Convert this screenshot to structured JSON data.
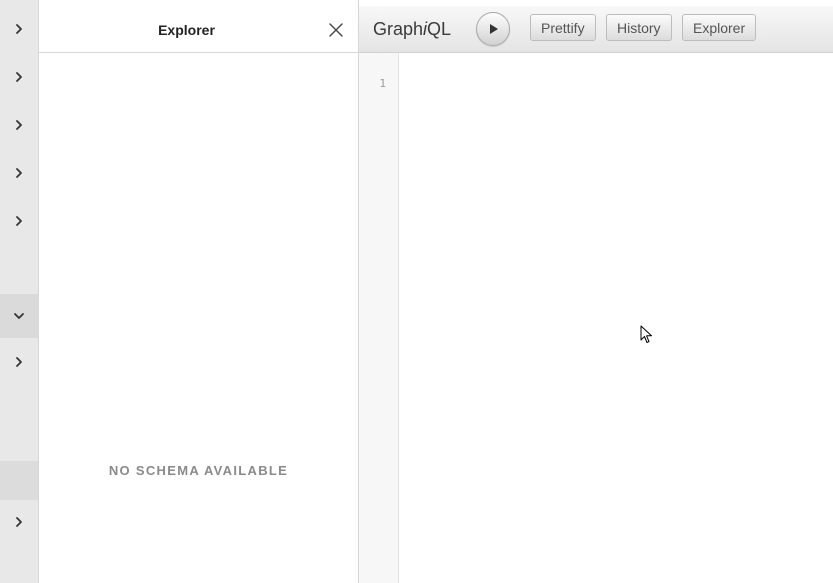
{
  "explorer": {
    "title": "Explorer",
    "empty_message": "NO SCHEMA AVAILABLE"
  },
  "toolbar": {
    "app_title_prefix": "Graph",
    "app_title_italic": "i",
    "app_title_suffix": "QL",
    "prettify_label": "Prettify",
    "history_label": "History",
    "explorer_label": "Explorer"
  },
  "editor": {
    "line_numbers": [
      "1"
    ]
  },
  "icons": {
    "run": "play-icon",
    "close": "close-icon",
    "rail_collapsed": "chevron-right-icon",
    "rail_expanded": "chevron-down-icon"
  },
  "colors": {
    "rail_bg": "#e8e8e8",
    "muted_text": "#8a8a8a",
    "toolbar_top": "#f8f8f8",
    "toolbar_bottom": "#e4e4e4"
  }
}
